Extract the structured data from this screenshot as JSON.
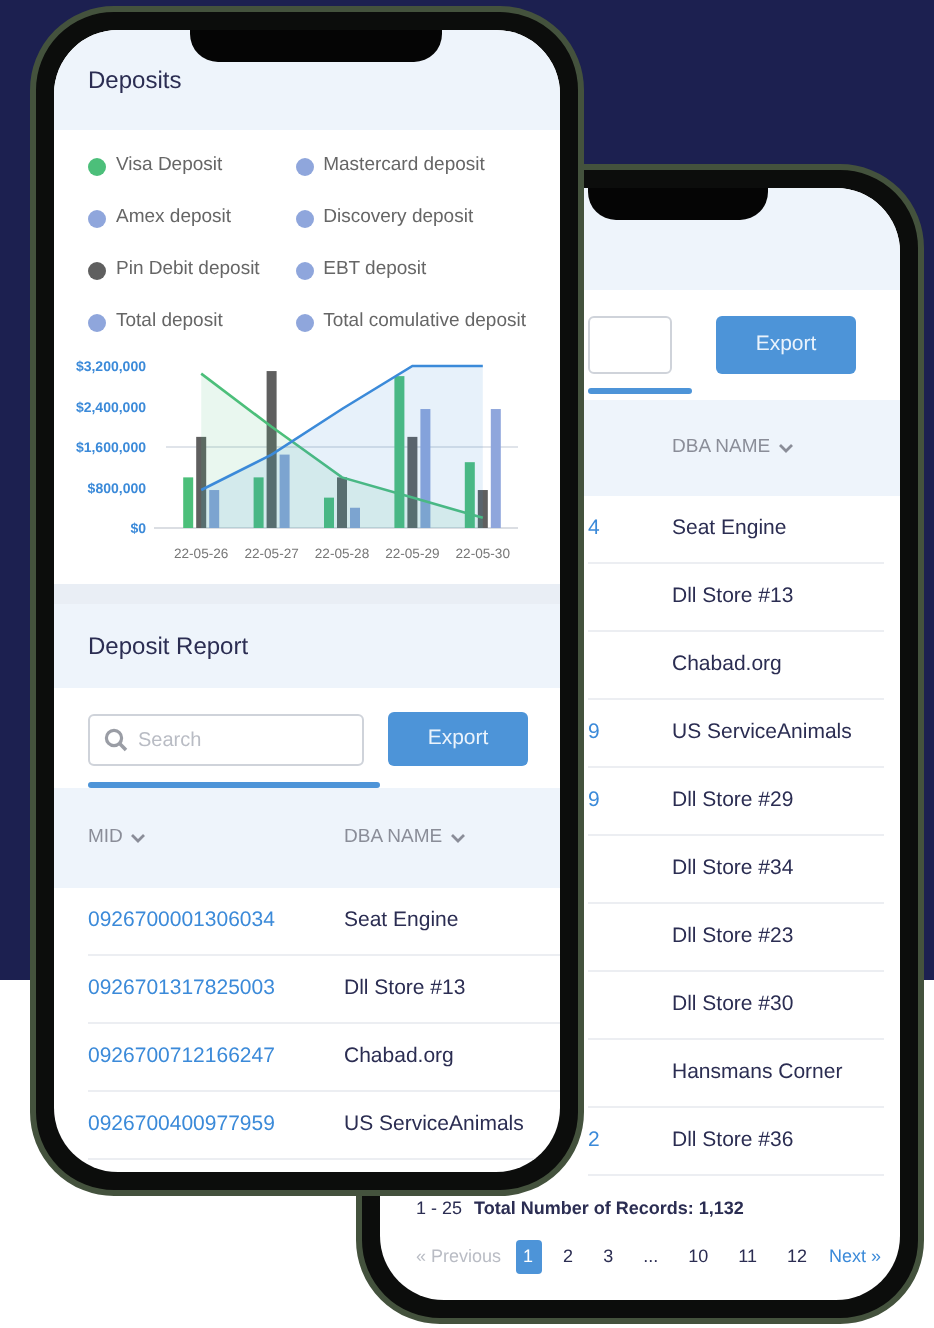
{
  "front_phone": {
    "deposits": {
      "title": "Deposits",
      "legend": [
        {
          "label": "Visa Deposit",
          "color": "#4cbf7a"
        },
        {
          "label": "Mastercard deposit",
          "color": "#8fa6dc"
        },
        {
          "label": "Amex deposit",
          "color": "#8fa6dc"
        },
        {
          "label": "Discovery deposit",
          "color": "#8fa6dc"
        },
        {
          "label": "Pin Debit deposit",
          "color": "#5f5f5f"
        },
        {
          "label": "EBT deposit",
          "color": "#8fa6dc"
        },
        {
          "label": "Total deposit",
          "color": "#8fa6dc"
        },
        {
          "label": "Total comulative deposit",
          "color": "#8fa6dc"
        }
      ],
      "chart_data": {
        "type": "bar",
        "categories": [
          "22-05-26",
          "22-05-27",
          "22-05-28",
          "22-05-29",
          "22-05-30"
        ],
        "ylim": [
          0,
          3200000
        ],
        "yticks": [
          {
            "value": 0,
            "label": "$0"
          },
          {
            "value": 800000,
            "label": "$800,000"
          },
          {
            "value": 1600000,
            "label": "$1,600,000"
          },
          {
            "value": 2400000,
            "label": "$2,400,000"
          },
          {
            "value": 3200000,
            "label": "$3,200,000"
          }
        ],
        "series": [
          {
            "color": "#4cbf7a",
            "type": "bar",
            "values": [
              1000000,
              1000000,
              600000,
              3000000,
              1300000
            ]
          },
          {
            "color": "#5f5f5f",
            "type": "bar",
            "values": [
              1800000,
              3100000,
              1000000,
              1800000,
              750000
            ]
          },
          {
            "color": "#8fa6dc",
            "type": "bar",
            "values": [
              750000,
              1450000,
              400000,
              2350000,
              2350000
            ]
          },
          {
            "color": "#4cbf7a",
            "type": "area",
            "values": [
              3050000,
              2000000,
              1000000,
              600000,
              200000
            ]
          },
          {
            "color": "#3b8ad9",
            "type": "area",
            "values": [
              750000,
              1450000,
              2350000,
              3200000,
              3200000
            ]
          }
        ]
      }
    },
    "report": {
      "title": "Deposit Report",
      "search": {
        "placeholder": "Search"
      },
      "export": "Export",
      "columns": [
        "MID",
        "DBA NAME"
      ],
      "rows": [
        {
          "mid": "0926700001306034",
          "dba": "Seat Engine"
        },
        {
          "mid": "0926701317825003",
          "dba": "Dll Store #13"
        },
        {
          "mid": "0926700712166247",
          "dba": "Chabad.org"
        },
        {
          "mid": "0926700400977959",
          "dba": "US ServiceAnimals"
        }
      ]
    }
  },
  "back_phone": {
    "export": "Export",
    "column": "DBA NAME",
    "rows": [
      {
        "mid": "4",
        "dba": "Seat Engine"
      },
      {
        "dba": "Dll Store #13"
      },
      {
        "dba": "Chabad.org"
      },
      {
        "mid": "9",
        "dba": "US ServiceAnimals"
      },
      {
        "mid": "9",
        "dba": "Dll Store #29"
      },
      {
        "dba": "Dll Store #34"
      },
      {
        "dba": "Dll Store #23"
      },
      {
        "dba": "Dll Store #30"
      },
      {
        "dba": "Hansmans Corner"
      },
      {
        "mid": "2",
        "dba": "Dll Store #36"
      }
    ],
    "range": "1 - 25",
    "total": "Total Number of Records: 1,132",
    "pagination": {
      "previous": {
        "label": "« Previous",
        "disabled": true
      },
      "pages": [
        {
          "label": "1",
          "selected": true
        },
        {
          "label": "2",
          "selected": false
        },
        {
          "label": "3",
          "selected": false
        },
        {
          "label": "...",
          "selected": false
        },
        {
          "label": "10",
          "selected": false
        },
        {
          "label": "11",
          "selected": false
        },
        {
          "label": "12",
          "selected": false
        }
      ],
      "next": {
        "label": "Next »",
        "disabled": false
      }
    }
  }
}
